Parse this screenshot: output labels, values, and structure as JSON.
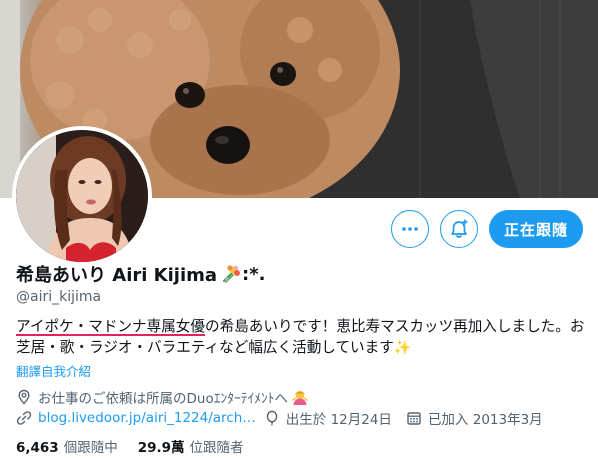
{
  "profile": {
    "display_name": "希島あいり Airi Kijima",
    "name_emoji": "bouquet-emoji",
    "name_suffix": ":*.",
    "handle": "@airi_kijima",
    "bio_link_text": "アイポケ・マドンナ専属女優",
    "bio_rest": "の希島あいりです！恵比寿マスカッツ再加入しました。お芝居・歌・ラジオ・バラエティなど幅広く活動しています",
    "bio_sparkle": "✨",
    "translate_label": "翻譯自我介紹",
    "location": "お仕事のご依頼は所属のDuoｴﾝﾀｰﾃｲﾒﾝﾄへ",
    "website": "blog.livedoor.jp/airi_1224/arch…",
    "birthday": "出生於 12月24日",
    "joined": "已加入 2013年3月",
    "following_count": "6,463",
    "following_label": "個跟隨中",
    "followers_count": "29.9萬",
    "followers_label": "位跟隨者"
  },
  "actions": {
    "more_icon": "more-icon",
    "notify_icon": "bell-plus-icon",
    "follow_label": "正在跟隨"
  },
  "colors": {
    "accent": "#1d9bf0",
    "underline": "#e0245e",
    "muted": "#536471"
  }
}
